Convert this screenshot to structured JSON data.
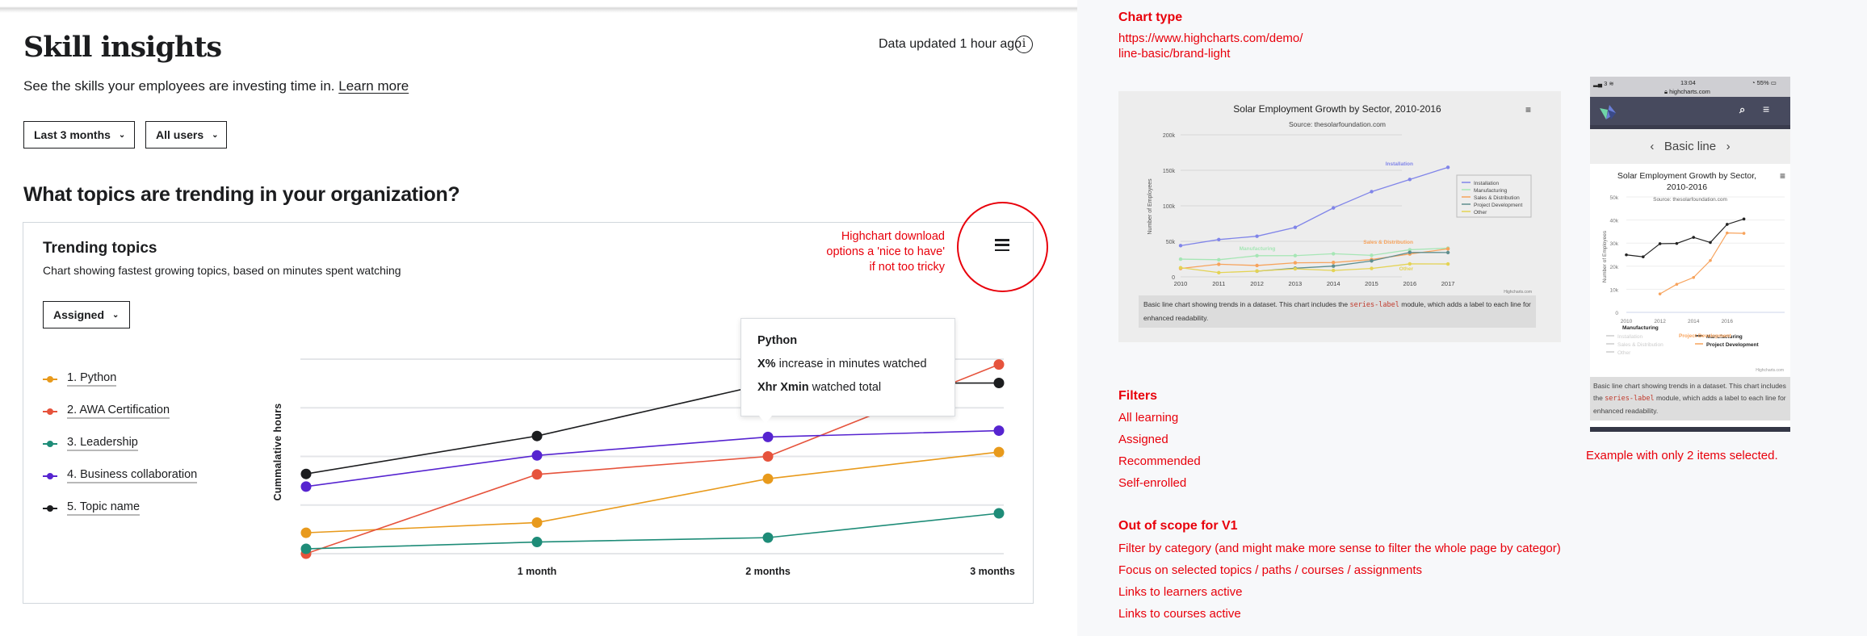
{
  "header": {
    "title": "Skill insights",
    "data_updated": "Data updated 1 hour ago",
    "info_icon": "info-icon",
    "subtitle": "See the skills your employees are investing time in.",
    "learn_more": "Learn more"
  },
  "filters": {
    "period": "Last 3 months",
    "users": "All users"
  },
  "section": {
    "heading": "What topics are trending in your organization?"
  },
  "card": {
    "title": "Trending topics",
    "subtitle": "Chart showing fastest growing topics, based on minutes spent watching",
    "filter": "Assigned",
    "menu_icon": "hamburger-menu-icon"
  },
  "annotation": {
    "note_lines": [
      "Highchart download",
      "options a 'nice to have'",
      "if not too tricky"
    ],
    "color": "#e8000b"
  },
  "legend": [
    {
      "label": "1. Python",
      "color": "#e89a1c"
    },
    {
      "label": "2. AWA Certification",
      "color": "#e6533c"
    },
    {
      "label": "3. Leadership",
      "color": "#1e8c78"
    },
    {
      "label": "4. Business collaboration",
      "color": "#5624d0"
    },
    {
      "label": "5. Topic name",
      "color": "#1c1d1f"
    }
  ],
  "tooltip": {
    "title": "Python",
    "line1_bold": "X%",
    "line1_rest": " increase in minutes watched",
    "line2_bold": "Xhr Xmin",
    "line2_rest": " watched total"
  },
  "chart_data": {
    "type": "line",
    "title": "",
    "xlabel": "",
    "ylabel": "Cummalative hours",
    "categories": [
      "",
      "1 month",
      "2 months",
      "3 months"
    ],
    "ylim": [
      0,
      4
    ],
    "grid": true,
    "legend_position": "left",
    "series": [
      {
        "name": "1. Python",
        "color": "#e89a1c",
        "values": [
          0.43,
          0.64,
          1.54,
          2.09
        ]
      },
      {
        "name": "2. AWA Certification",
        "color": "#e6533c",
        "values": [
          0,
          1.63,
          2.0,
          3.89
        ]
      },
      {
        "name": "3. Leadership",
        "color": "#1e8c78",
        "values": [
          0.1,
          0.24,
          0.33,
          0.83
        ]
      },
      {
        "name": "4. Business collaboration",
        "color": "#5624d0",
        "values": [
          1.38,
          2.02,
          2.4,
          2.53
        ]
      },
      {
        "name": "5. Topic name",
        "color": "#1c1d1f",
        "values": [
          1.64,
          2.42,
          3.5,
          3.51
        ]
      }
    ]
  },
  "notes": {
    "chart_type_heading": "Chart type",
    "chart_type_link": [
      "https://www.highcharts.com/demo/",
      "line-basic/brand-light"
    ],
    "filters_heading": "Filters",
    "filters": [
      "All learning",
      "Assigned",
      "Recommended",
      "Self-enrolled"
    ],
    "out_of_scope_heading": "Out of scope for V1",
    "out_of_scope": [
      "Filter by category (and might make more sense to filter the whole page by categor)",
      "Focus on selected topics / paths / courses / assignments",
      "Links to learners active",
      "Links to courses active"
    ],
    "example_caption": "Example with only 2 items selected."
  },
  "reference_desktop": {
    "title": "Solar Employment Growth by Sector, 2010-2016",
    "source": "Source: thesolarfoundation.com",
    "ylabel": "Number of Employees",
    "yticks": [
      "0",
      "50k",
      "100k",
      "150k",
      "200k"
    ],
    "years": [
      "2010",
      "2011",
      "2012",
      "2013",
      "2014",
      "2015",
      "2016",
      "2017"
    ],
    "credits": "Highcharts.com",
    "description_pre": "Basic line chart showing trends in a dataset. This chart includes the ",
    "description_code": "series-label",
    "description_post": " module, which adds a label to each line for enhanced readability.",
    "series": [
      {
        "name": "Installation",
        "color": "#8085e9",
        "values": [
          43934,
          52503,
          57177,
          69658,
          97031,
          119931,
          137133,
          154175
        ]
      },
      {
        "name": "Manufacturing",
        "color": "#a6e6b5",
        "values": [
          24916,
          24064,
          29742,
          29851,
          32490,
          30282,
          38121,
          40434
        ]
      },
      {
        "name": "Sales & Distribution",
        "color": "#f7a35c",
        "values": [
          11744,
          17722,
          16005,
          19771,
          20185,
          24377,
          32147,
          39387
        ]
      },
      {
        "name": "Project Development",
        "color": "#5f8e8e",
        "values": [
          null,
          null,
          7988,
          12169,
          15112,
          22452,
          34400,
          34227
        ]
      },
      {
        "name": "Other",
        "color": "#e4d354",
        "values": [
          12908,
          5948,
          8105,
          11248,
          8989,
          11816,
          18274,
          18111
        ]
      }
    ]
  },
  "reference_mobile": {
    "status_signal": "3",
    "time": "13:04",
    "battery": "55%",
    "url": "highcharts.com",
    "page_title": "Basic line",
    "title_lines": [
      "Solar Employment Growth by Sector,",
      "2010-2016"
    ],
    "source": "Source: thesolarfoundation.com",
    "ylabel": "Number of Employees",
    "yticks": [
      "0",
      "10k",
      "20k",
      "30k",
      "40k",
      "50k"
    ],
    "xticks": [
      "2010",
      "2012",
      "2014",
      "2016"
    ],
    "legend_inactive": [
      "Installation",
      "Sales & Distribution",
      "Other"
    ],
    "credits": "Highcharts.com",
    "description_pre": "Basic line chart showing trends in a dataset. This chart includes the ",
    "description_code": "series-label",
    "description_post": " module, which adds a label to each line for enhanced readability.",
    "series": [
      {
        "name": "Manufacturing",
        "color": "#222222",
        "values": [
          24916,
          24064,
          29742,
          29851,
          32490,
          30282,
          38121,
          40434
        ]
      },
      {
        "name": "Project Development",
        "color": "#f7a35c",
        "values": [
          null,
          null,
          7988,
          12169,
          15112,
          22452,
          34400,
          34227
        ]
      }
    ]
  }
}
